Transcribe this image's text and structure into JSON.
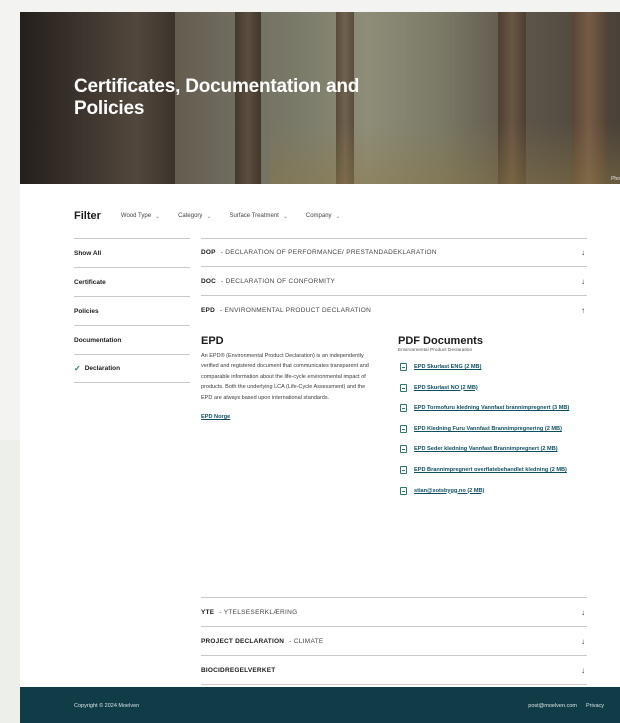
{
  "hero": {
    "title": "Certificates, Documentation and Policies",
    "credit": "Pho"
  },
  "filter": {
    "title": "Filter",
    "dropdowns": [
      "Wood Type",
      "Category",
      "Surface Treatment",
      "Company"
    ]
  },
  "sidebar": {
    "items": [
      {
        "label": "Show All",
        "checked": false
      },
      {
        "label": "Certificate",
        "checked": false
      },
      {
        "label": "Policies",
        "checked": false
      },
      {
        "label": "Documentation",
        "checked": false
      },
      {
        "label": "Declaration",
        "checked": true
      }
    ]
  },
  "accordion": {
    "rows_top": [
      {
        "code": "DOP",
        "desc": "- DECLARATION OF PERFORMANCE/ PRESTANDADEKLARATION",
        "arrow": "↓"
      },
      {
        "code": "DOC",
        "desc": "- DECLARATION OF CONFORMITY",
        "arrow": "↓"
      },
      {
        "code": "EPD",
        "desc": "- ENVIRONMENTAL PRODUCT DECLARATION",
        "arrow": "↑"
      }
    ],
    "rows_bottom": [
      {
        "code": "YTE",
        "desc": "- YTELSESERKLÆRING",
        "arrow": "↓"
      },
      {
        "code": "PROJECT DECLARATION",
        "desc": "- CLIMATE",
        "arrow": "↓"
      },
      {
        "code": "BIOCIDREGELVERKET",
        "desc": "",
        "arrow": "↓"
      }
    ]
  },
  "epd_panel": {
    "heading": "EPD",
    "text": "An EPD® (Environmental Product Declaration) is an independently verified and registered document that communicates transparent and comparable information about the life-cycle environmental impact of products. Both the underlying LCA (Life-Cycle Assessment) and the EPD are always based upon international standards.",
    "link": "EPD Norge",
    "pdf_heading": "PDF Documents",
    "pdf_subheading": "Environmental Product Declaration",
    "documents": [
      "EPD Skurlast ENG (2 MB)",
      "EPD Skurlast NO (2 MB)",
      "EPD Tormofuru kledning Vannfast brannimpregnert (3 MB)",
      "EPD Kledning Furu Vannfast Brannimpregnering (2 MB)",
      "EPD Seder kledning Vannfast Brannimpregnert (2 MB)",
      "EPD Brannimpregnert overflatebehandlet kledning (2 MB)",
      "stian@sotsbygg.no (2 MB)"
    ]
  },
  "footer": {
    "copyright": "Copyright © 2024 Moelven",
    "email": "post@moelven.com",
    "privacy": "Privacy"
  },
  "colors": {
    "footer_bg": "#0f3c46",
    "link": "#0f4f63",
    "check": "#2e7a5e"
  }
}
